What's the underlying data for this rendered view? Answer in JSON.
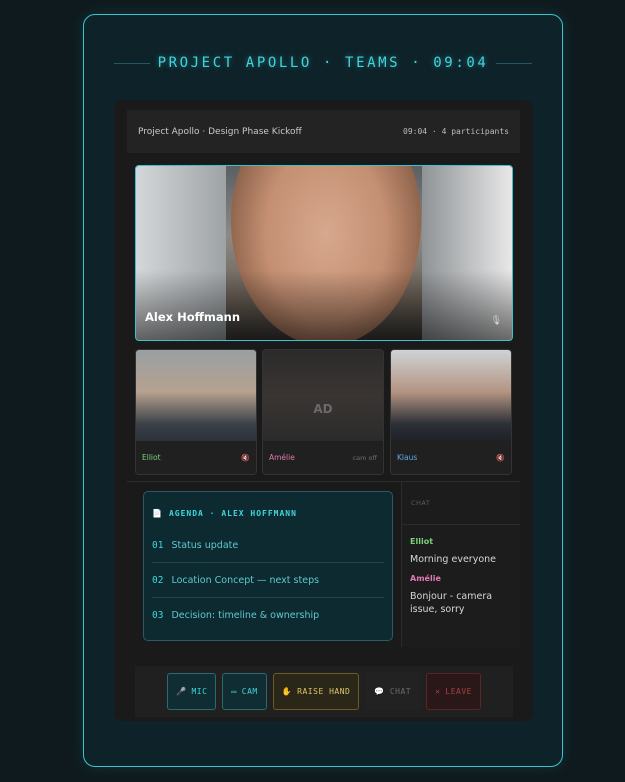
{
  "hud": {
    "title": "PROJECT APOLLO · TEAMS · 09:04"
  },
  "titlebar": {
    "meeting_title": "Project Apollo · Design Phase Kickoff",
    "meta": "09:04 · 4 participants"
  },
  "main_speaker": {
    "name": "Alex Hoffmann",
    "mic_icon": "mic-icon"
  },
  "participants": [
    {
      "name": "Elliot",
      "color": "#7bd07a",
      "status_icon": "muted-speaker-icon"
    },
    {
      "name": "Amélie",
      "color": "#e27ab0",
      "initials": "AD",
      "status": "cam off"
    },
    {
      "name": "Klaus",
      "color": "#5ea8e8",
      "status_icon": "muted-speaker-icon"
    }
  ],
  "agenda": {
    "header": "AGENDA · ALEX HOFFMANN",
    "icon": "document-icon",
    "items": [
      {
        "num": "01",
        "text": "Status update"
      },
      {
        "num": "02",
        "text": "Location Concept — next steps"
      },
      {
        "num": "03",
        "text": "Decision: timeline & ownership"
      }
    ]
  },
  "chat": {
    "header": "CHAT",
    "messages": [
      {
        "author": "Elliot",
        "author_color": "#7bd07a",
        "text": "Morning everyone"
      },
      {
        "author": "Amélie",
        "author_color": "#e27ab0",
        "text": "Bonjour - camera issue, sorry"
      }
    ]
  },
  "controls": {
    "mic": "MIC",
    "cam": "CAM",
    "raise_hand": "RAISE HAND",
    "chat": "CHAT",
    "leave": "LEAVE"
  }
}
